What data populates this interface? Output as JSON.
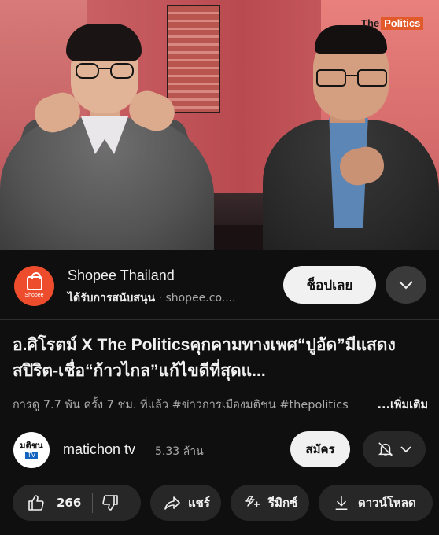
{
  "video": {
    "watermark_the": "The",
    "watermark_brand": "Politics"
  },
  "ad": {
    "logo_word": "Shopee",
    "advertiser": "Shopee Thailand",
    "sponsored_label": "ได้รับการสนับสนุน",
    "separator": "·",
    "domain": "shopee.co....",
    "cta_label": "ช็อปเลย",
    "expand_icon": "chevron-down-icon"
  },
  "video_info": {
    "title": "อ.ศิโรตม์ X The Politicsคุกคามทางเพศ“ปูอัด”มีแสดงสปิริต-เชื่อ“ก้าวไกล”แก้ไขดีที่สุดแ...",
    "meta": "การดู 7.7 พัน ครั้ง  7 ชม. ที่แล้ว  #ข่าวการเมืองมติชน  #thepolitics",
    "more_label": "...เพิ่มเติม"
  },
  "channel": {
    "avatar_text_top": "มติชน",
    "avatar_text_bottom": "TV",
    "name": "matichon tv",
    "subscribers": "5.33 ล้าน",
    "subscribe_label": "สมัคร",
    "bell_icon": "bell-off-icon"
  },
  "actions": {
    "like_count": "266",
    "share_label": "แชร์",
    "remix_label": "รีมิกซ์",
    "download_label": "ดาวน์โหลด"
  },
  "colors": {
    "background": "#0f0f0f",
    "pill": "#272727",
    "shopee": "#ee4d2d",
    "text_secondary": "#aaaaaa"
  }
}
